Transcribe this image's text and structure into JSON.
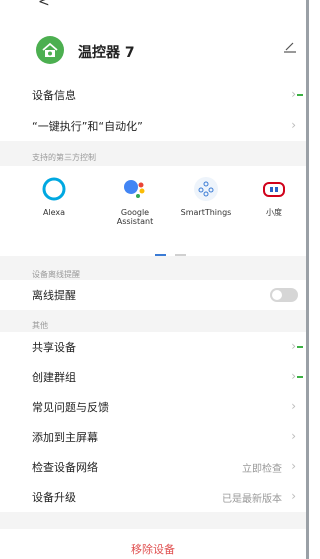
{
  "colors": {
    "accent": "#4caf50",
    "danger": "#e05050",
    "toggle_off": "#d6d6d6"
  },
  "topbar": {
    "back": "<"
  },
  "header": {
    "device_name": "温控器 7",
    "edit_icon": "∠"
  },
  "rows": {
    "device_info": "设备信息",
    "one_click": "“一键执行”和“自动化”"
  },
  "third_party": {
    "section_title": "支持的第三方控制",
    "items": [
      "Alexa",
      "Google\nAssistant",
      "SmartThings",
      "小度"
    ]
  },
  "offline": {
    "section_title": "设备离线提醒",
    "label": "离线提醒",
    "enabled": false
  },
  "other": {
    "section_title": "其他",
    "share": "共享设备",
    "group": "创建群组",
    "faq": "常见问题与反馈",
    "home_screen": "添加到主屏幕",
    "network": "检查设备网络",
    "network_value": "立即检查",
    "upgrade": "设备升级",
    "upgrade_value": "已是最新版本"
  },
  "remove_label": "移除设备"
}
